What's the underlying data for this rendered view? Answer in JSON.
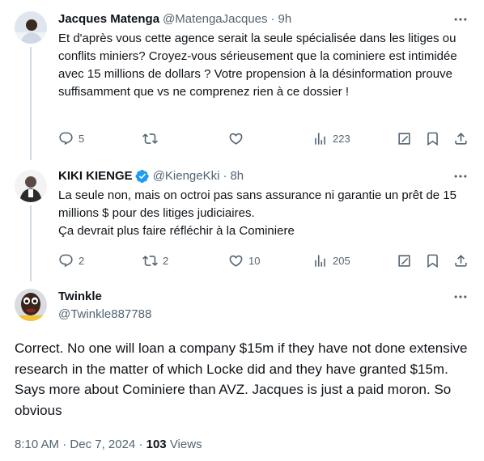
{
  "tweets": [
    {
      "name": "Jacques Matenga",
      "handle": "@MatengaJacques",
      "time": "9h",
      "text": "Et d'après vous cette agence serait la seule spécialisée dans les litiges ou conflits miniers?  Croyez-vous sérieusement que la cominiere est intimidée avec 15 millions de dollars ? Votre propension à la désinformation prouve suffisamment que vs ne comprenez rien à ce dossier !",
      "replies": "5",
      "retweets": "",
      "likes": "",
      "views": "223"
    },
    {
      "name": "KIKI KIENGE",
      "handle": "@KiengeKki",
      "time": "8h",
      "verified": true,
      "text": "La seule non, mais on octroi pas sans assurance ni garantie un prêt de 15 millions $ pour des litiges judiciaires.\nÇa devrait plus faire réfléchir à la Cominiere",
      "replies": "2",
      "retweets": "2",
      "likes": "10",
      "views": "205"
    }
  ],
  "main": {
    "name": "Twinkle",
    "handle": "@Twinkle887788",
    "text": "Correct. No one will loan a company $15m if they have not done extensive research in the matter of which Locke did and they have granted $15m. Says more about Cominiere than AVZ. Jacques is just a paid moron. So obvious",
    "time": "8:10 AM",
    "date": "Dec 7, 2024",
    "views_count": "103",
    "views_label": "Views"
  },
  "separator": "·",
  "colors": {
    "text": "#0f1419",
    "secondary": "#536471",
    "verified": "#1d9bf0",
    "thread_line": "#cfd9de"
  },
  "icons": [
    "reply-icon",
    "retweet-icon",
    "like-icon",
    "views-icon",
    "grok-icon",
    "bookmark-icon",
    "share-icon",
    "more-icon",
    "verified-icon"
  ]
}
